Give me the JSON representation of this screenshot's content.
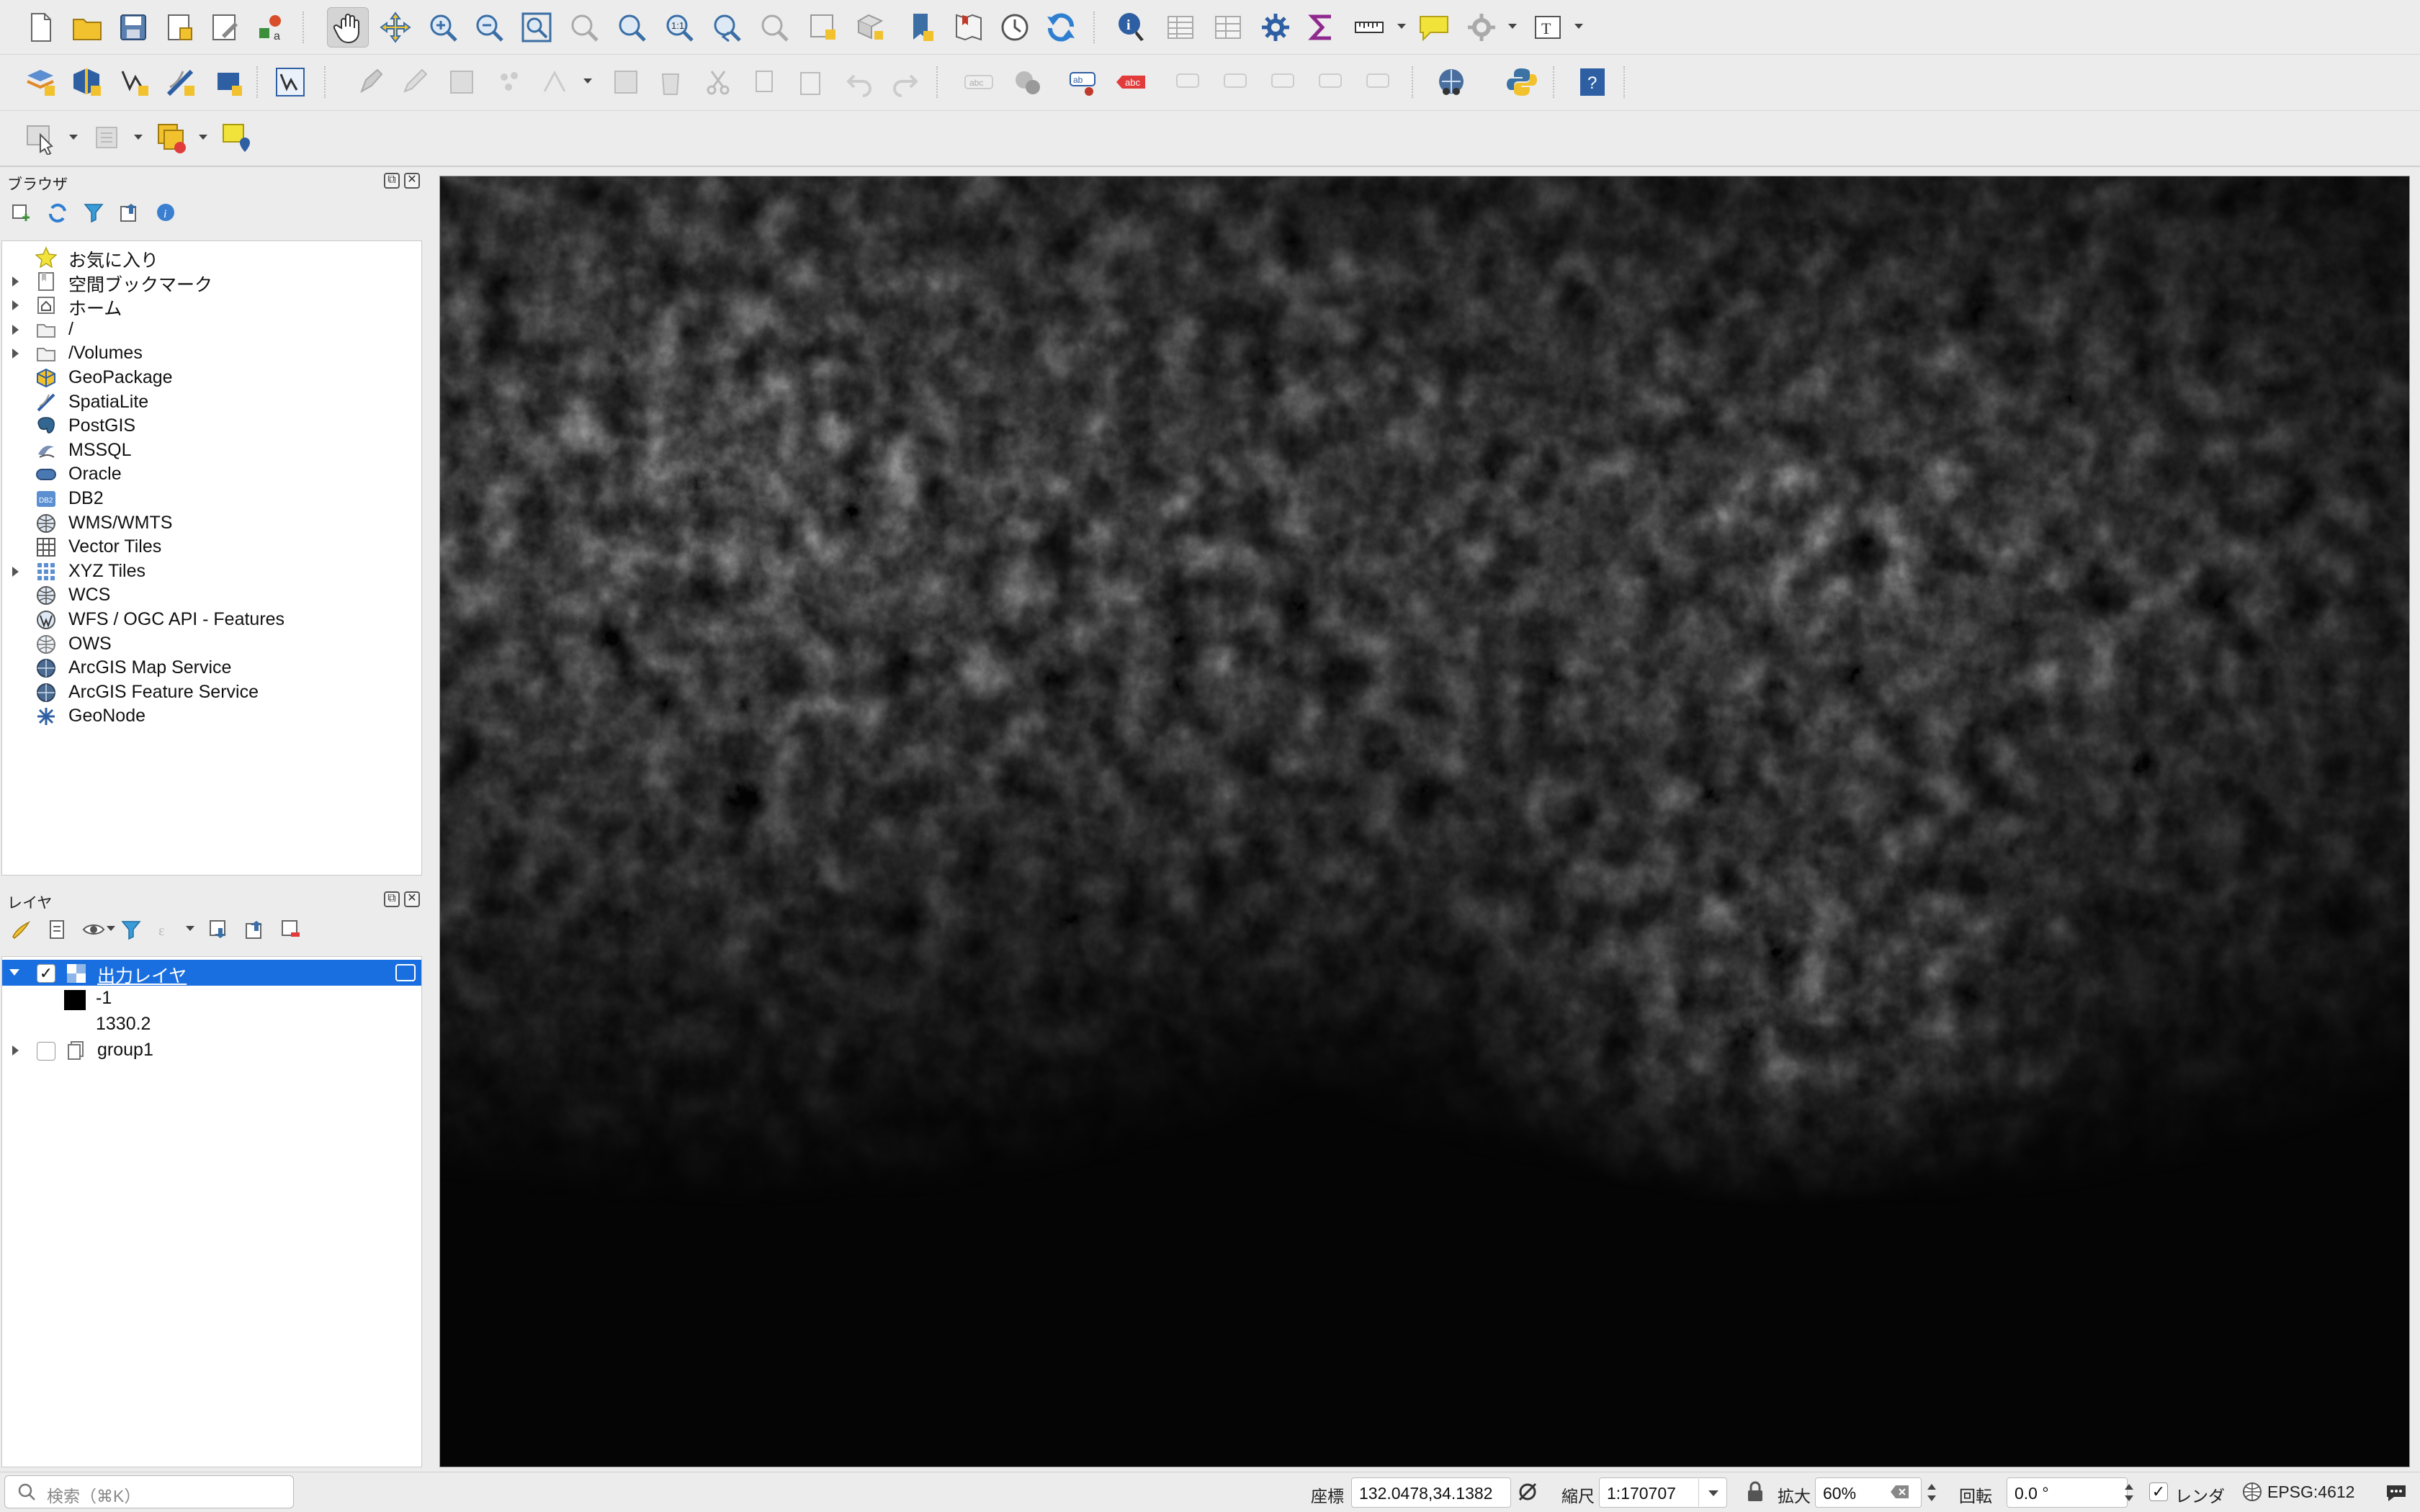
{
  "toolbar": {
    "icons": [
      "new-project-icon",
      "open-project-icon",
      "save-project-icon",
      "new-print-layout-icon",
      "layout-manager-icon",
      "style-manager-icon",
      "pan-map-icon",
      "pan-to-selection-icon",
      "zoom-in-icon",
      "zoom-out-icon",
      "zoom-full-icon",
      "zoom-to-selection-icon",
      "zoom-to-layer-icon",
      "zoom-native-resolution-icon",
      "zoom-last-icon",
      "zoom-next-icon",
      "new-map-view-icon",
      "new-3d-map-view-icon",
      "new-spatial-bookmark-icon",
      "show-bookmarks-icon",
      "temporal-controller-icon",
      "refresh-icon",
      "identify-features-icon",
      "attribute-table-icon",
      "field-calculator-icon",
      "processing-toolbox-icon",
      "statistical-summary-icon",
      "measure-icon",
      "map-tips-icon",
      "settings-icon",
      "text-annotation-icon"
    ]
  },
  "browser_panel": {
    "title": "ブラウザ",
    "items": [
      {
        "label": "お気に入り",
        "icon": "favorites-star-icon",
        "expandable": false
      },
      {
        "label": "空間ブックマーク",
        "icon": "spatial-bookmarks-icon",
        "expandable": true
      },
      {
        "label": "ホーム",
        "icon": "home-folder-icon",
        "expandable": true
      },
      {
        "label": "/",
        "icon": "root-folder-icon",
        "expandable": true
      },
      {
        "label": "/Volumes",
        "icon": "volumes-folder-icon",
        "expandable": true
      },
      {
        "label": "GeoPackage",
        "icon": "geopackage-icon",
        "expandable": false
      },
      {
        "label": "SpatiaLite",
        "icon": "spatialite-icon",
        "expandable": false
      },
      {
        "label": "PostGIS",
        "icon": "postgis-icon",
        "expandable": false
      },
      {
        "label": "MSSQL",
        "icon": "mssql-icon",
        "expandable": false
      },
      {
        "label": "Oracle",
        "icon": "oracle-icon",
        "expandable": false
      },
      {
        "label": "DB2",
        "icon": "db2-icon",
        "expandable": false
      },
      {
        "label": "WMS/WMTS",
        "icon": "wms-globe-icon",
        "expandable": false
      },
      {
        "label": "Vector Tiles",
        "icon": "vector-tiles-icon",
        "expandable": false
      },
      {
        "label": "XYZ Tiles",
        "icon": "xyz-tiles-icon",
        "expandable": true
      },
      {
        "label": "WCS",
        "icon": "wcs-globe-icon",
        "expandable": false
      },
      {
        "label": "WFS / OGC API - Features",
        "icon": "wfs-icon",
        "expandable": false
      },
      {
        "label": "OWS",
        "icon": "ows-globe-icon",
        "expandable": false
      },
      {
        "label": "ArcGIS Map Service",
        "icon": "arcgis-map-icon",
        "expandable": false
      },
      {
        "label": "ArcGIS Feature Service",
        "icon": "arcgis-feature-icon",
        "expandable": false
      },
      {
        "label": "GeoNode",
        "icon": "geonode-icon",
        "expandable": false
      }
    ]
  },
  "layers_panel": {
    "title": "レイヤ",
    "layer": {
      "name": "出力レイヤ",
      "checked": true,
      "legend_min": "-1",
      "legend_max": "1330.2"
    },
    "group": {
      "name": "group1",
      "checked": false
    }
  },
  "statusbar": {
    "search_placeholder": "検索（⌘K）",
    "coordinate_label": "座標",
    "coordinate_value": "132.0478,34.1382",
    "scale_label": "縮尺",
    "scale_value": "1:170707",
    "magnifier_label": "拡大",
    "magnifier_value": "60%",
    "rotation_label": "回転",
    "rotation_value": "0.0 °",
    "render_label": "レンダ",
    "crs_label": "EPSG:4612"
  },
  "colors": {
    "selection": "#1a6fe0",
    "map_background": "#050505",
    "panel_bg": "#ececec"
  }
}
